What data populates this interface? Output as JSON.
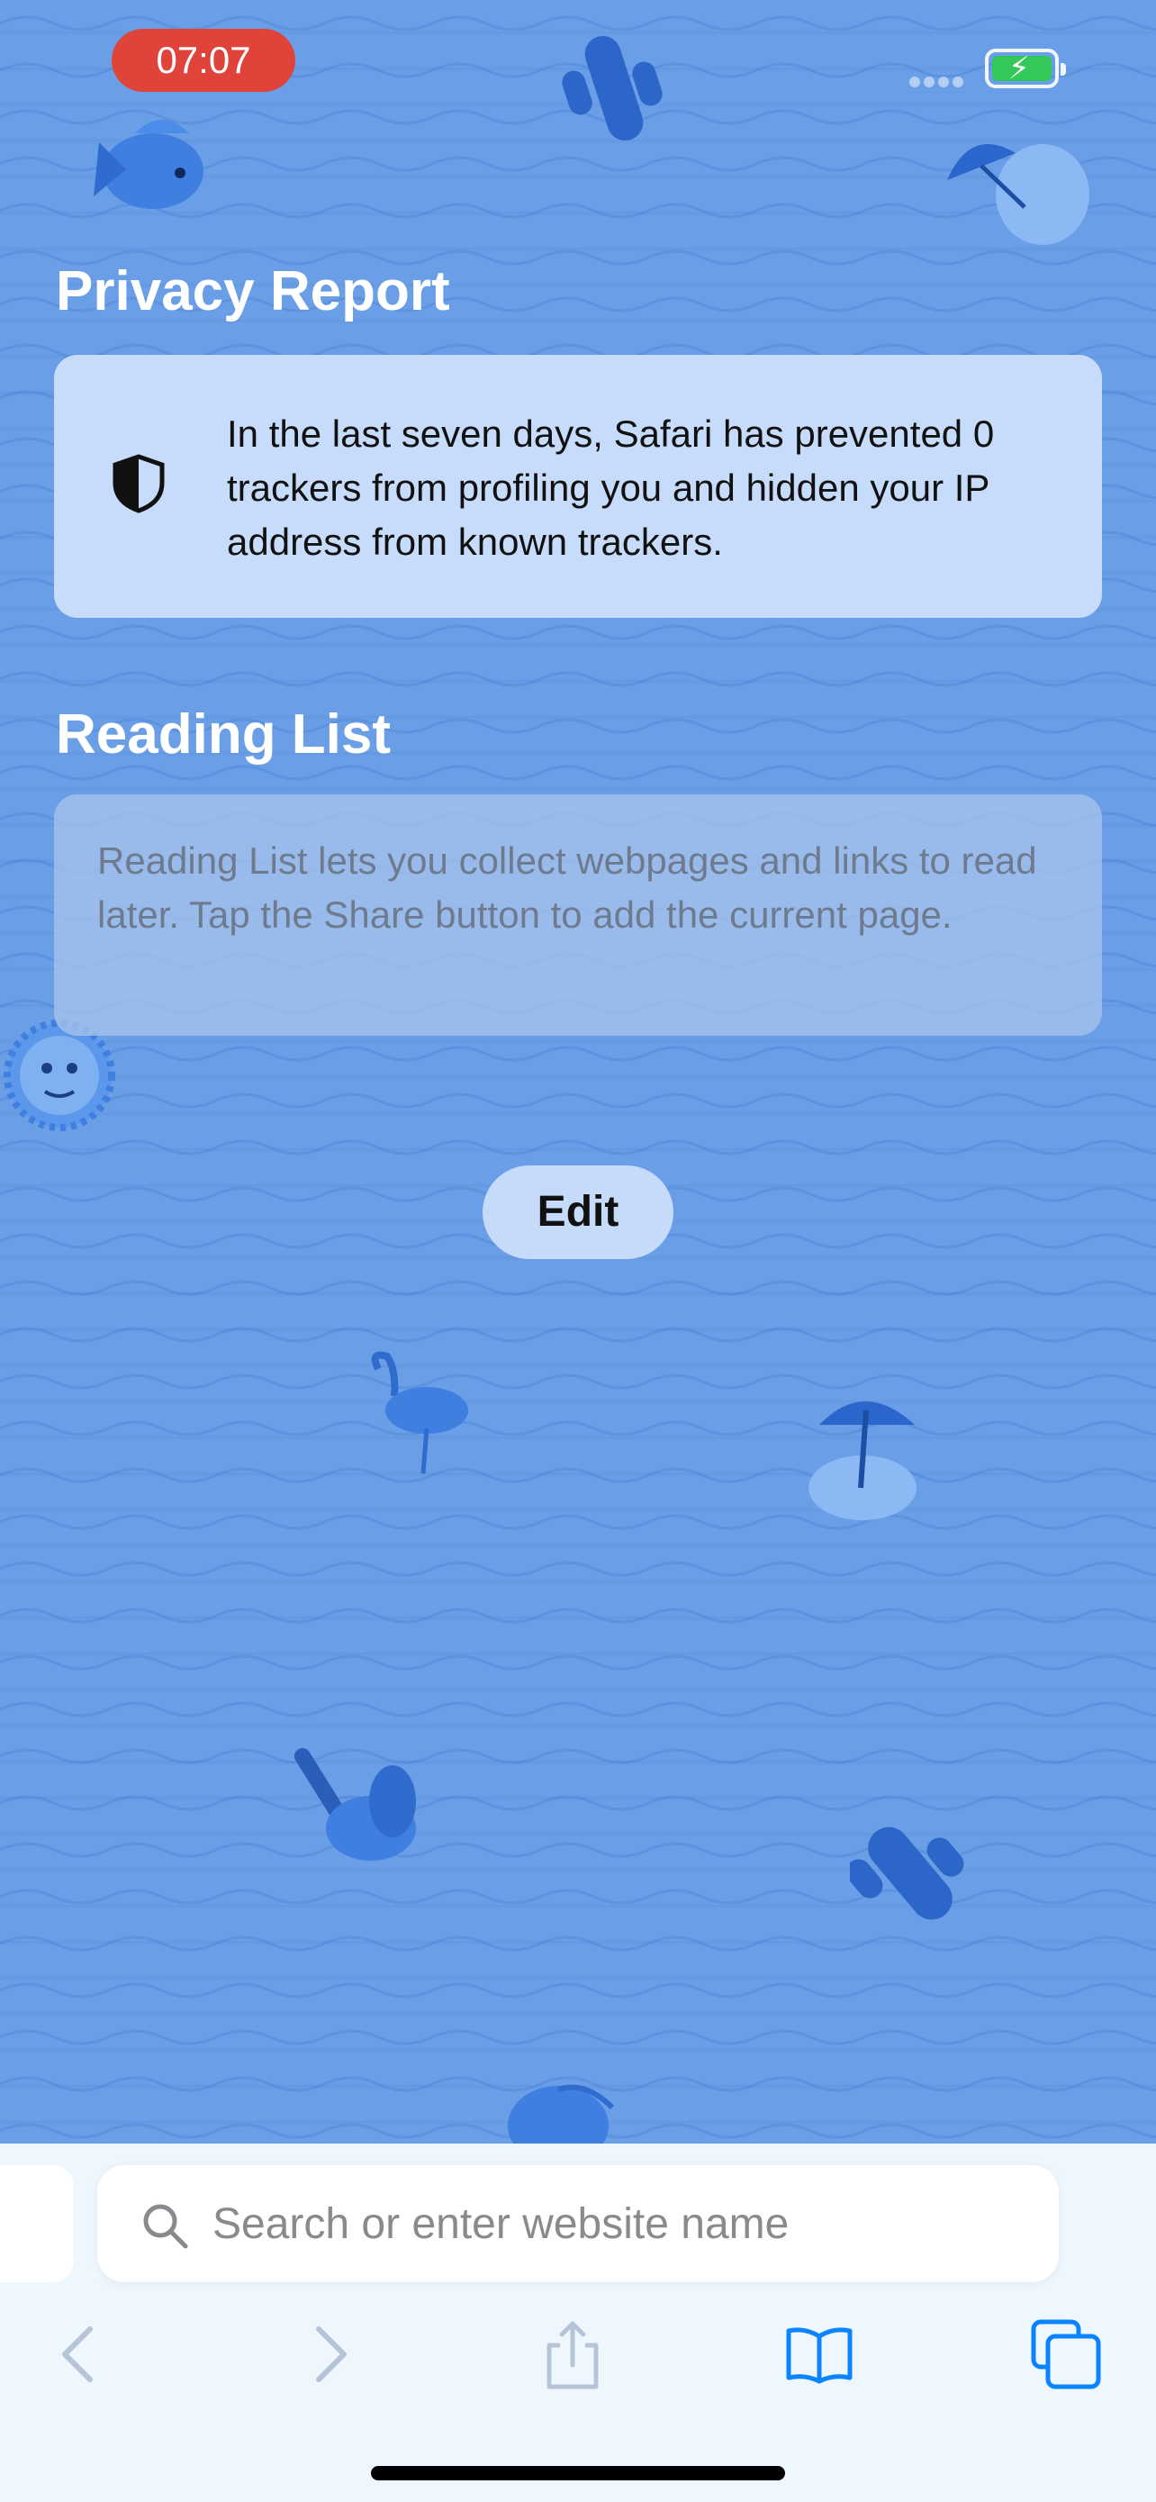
{
  "status_bar": {
    "time": "07:07",
    "time_badge_color": "#e0433a",
    "battery_color": "#34c759",
    "battery_state": "charging"
  },
  "privacy_report": {
    "title": "Privacy Report",
    "icon": "shield-icon",
    "message": "In the last seven days, Safari has prevented 0 trackers from profiling you and hidden your IP address from known trackers."
  },
  "reading_list": {
    "title": "Reading List",
    "empty_message": "Reading List lets you collect webpages and links to read later. Tap the Share button to add the current page."
  },
  "edit_button": {
    "label": "Edit"
  },
  "search": {
    "placeholder": "Search or enter website name",
    "icon": "search-icon"
  },
  "toolbar": {
    "items": [
      "back-icon",
      "forward-icon",
      "share-icon",
      "bookmarks-icon",
      "tabs-icon"
    ],
    "accent_color": "#0a84ff"
  },
  "background": {
    "color": "#6a9fe7",
    "decorations": [
      "fish",
      "cactus",
      "beach-umbrella",
      "sun-face",
      "flamingo",
      "palm-tree"
    ]
  }
}
